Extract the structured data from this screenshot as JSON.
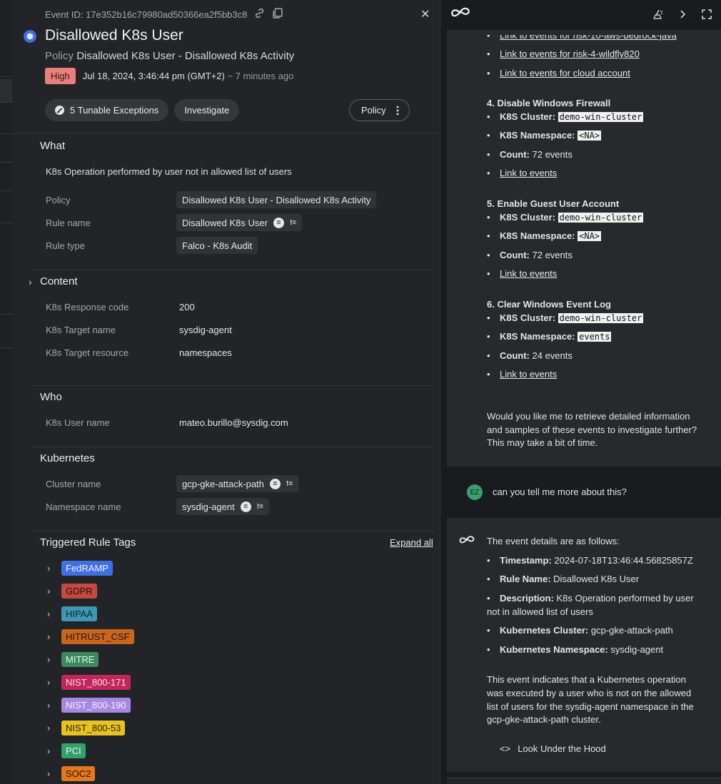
{
  "event": {
    "id_text": "Event ID: 17e352b16c79980ad50366ea2f5bb3c8",
    "title": "Disallowed K8s User",
    "policy_label": "Policy",
    "policy_value": "Disallowed K8s User - Disallowed K8s Activity",
    "severity": "High",
    "timestamp": "Jul 18, 2024, 3:46:44 pm (GMT+2)",
    "ago": "~ 7 minutes ago",
    "buttons": {
      "exceptions": "5 Tunable Exceptions",
      "investigate": "Investigate",
      "policy": "Policy"
    },
    "colors": {
      "high": "#e8807c",
      "k8s_logo": "#3d6fe1"
    }
  },
  "what": {
    "heading": "What",
    "description": "K8s Operation performed by user not in allowed list of users",
    "rows": [
      {
        "label": "Policy",
        "value": "Disallowed K8s User - Disallowed K8s Activity"
      },
      {
        "label": "Rule name",
        "value": "Disallowed K8s User",
        "eq": "=",
        "ne": "!="
      },
      {
        "label": "Rule type",
        "value": "Falco - K8s Audit"
      }
    ]
  },
  "content": {
    "heading": "Content",
    "rows": [
      {
        "label": "K8s Response code",
        "value": "200"
      },
      {
        "label": "K8s Target name",
        "value": "sysdig-agent"
      },
      {
        "label": "K8s Target resource",
        "value": "namespaces"
      }
    ]
  },
  "who": {
    "heading": "Who",
    "rows": [
      {
        "label": "K8s User name",
        "value": "mateo.burillo@sysdig.com"
      }
    ]
  },
  "kubernetes": {
    "heading": "Kubernetes",
    "rows": [
      {
        "label": "Cluster name",
        "value": "gcp-gke-attack-path",
        "eq": "=",
        "ne": "!="
      },
      {
        "label": "Namespace name",
        "value": "sysdig-agent",
        "eq": "=",
        "ne": "!="
      }
    ]
  },
  "tags": {
    "heading": "Triggered Rule Tags",
    "expand_all": "Expand all",
    "items": [
      {
        "label": "FedRAMP",
        "bg": "#3f6fe0",
        "fg": "#eef2ff"
      },
      {
        "label": "GDPR",
        "bg": "#c24a42",
        "fg": "#2a0d0b"
      },
      {
        "label": "HIPAA",
        "bg": "#3e97b6",
        "fg": "#0e2530"
      },
      {
        "label": "HITRUST_CSF",
        "bg": "#c8661f",
        "fg": "#2b1405"
      },
      {
        "label": "MITRE",
        "bg": "#3c8a5e",
        "fg": "#e9f5ee"
      },
      {
        "label": "NIST_800-171",
        "bg": "#c2275a",
        "fg": "#f5dde6"
      },
      {
        "label": "NIST_800-190",
        "bg": "#a68ae0",
        "fg": "#f3eeff"
      },
      {
        "label": "NIST_800-53",
        "bg": "#e6c224",
        "fg": "#2e2504"
      },
      {
        "label": "PCI",
        "bg": "#35a06a",
        "fg": "#e7f7ee"
      },
      {
        "label": "SOC2",
        "bg": "#e2771f",
        "fg": "#2e1604"
      }
    ]
  },
  "chat": {
    "top_links": [
      "Link to events for risk-10-aws-bedrock-java",
      "Link to events for risk-4-wildfly820",
      "Link to events for cloud account"
    ],
    "items": [
      {
        "title": "4. Disable Windows Firewall",
        "cluster_label": "K8S Cluster:",
        "cluster": "demo-win-cluster",
        "ns_label": "K8S Namespace:",
        "ns": "<NA>",
        "count_label": "Count:",
        "count": "72 events",
        "link": "Link to events"
      },
      {
        "title": "5. Enable Guest User Account",
        "cluster_label": "K8S Cluster:",
        "cluster": "demo-win-cluster",
        "ns_label": "K8S Namespace:",
        "ns": "<NA>",
        "count_label": "Count:",
        "count": "72 events",
        "link": "Link to events"
      },
      {
        "title": "6. Clear Windows Event Log",
        "cluster_label": "K8S Cluster:",
        "cluster": "demo-win-cluster",
        "ns_label": "K8S Namespace:",
        "ns": "events",
        "count_label": "Count:",
        "count": "24 events",
        "link": "Link to events"
      }
    ],
    "followup": [
      "Would you like me to retrieve detailed information",
      "and samples of these events to investigate further?",
      "This may take a bit of time."
    ],
    "user_initials": "EZ",
    "user_question": "can you tell me more about this?",
    "answer_intro": "The event details are as follows:",
    "details": [
      {
        "label": "Timestamp:",
        "value": "2024-07-18T13:46:44.56825857Z"
      },
      {
        "label": "Rule Name:",
        "value": "Disallowed K8s User"
      },
      {
        "label": "Description:",
        "value": "K8s Operation performed by user",
        "value2": "not in allowed list of users"
      },
      {
        "label": "Kubernetes Cluster:",
        "value": "gcp-gke-attack-path"
      },
      {
        "label": "Kubernetes Namespace:",
        "value": "sysdig-agent"
      }
    ],
    "summary": [
      "This event indicates that a Kubernetes operation",
      "was executed by a user who is not on the allowed",
      "list of users for the sysdig-agent namespace in the",
      "gcp-gke-attack-path cluster."
    ],
    "look_under_hood": "Look Under the Hood",
    "code_icon": "<>"
  }
}
